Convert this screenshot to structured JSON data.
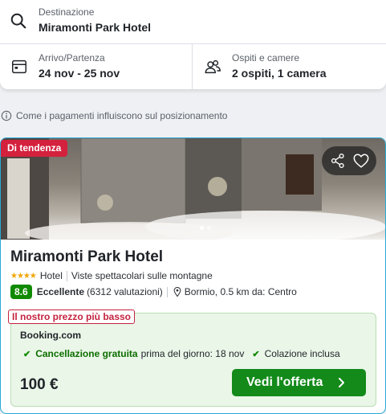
{
  "search": {
    "destination_label": "Destinazione",
    "destination_value": "Miramonti Park Hotel",
    "dates_label": "Arrivo/Partenza",
    "dates_value": "24 nov - 25 nov",
    "guests_label": "Ospiti e camere",
    "guests_value": "2 ospiti, 1 camera"
  },
  "info_text": "Come i pagamenti influiscono sul posizionamento",
  "hotel": {
    "badge": "Di tendenza",
    "name": "Miramonti Park Hotel",
    "star_glyphs": "★★★★",
    "type": "Hotel",
    "highlight": "Viste spettacolari sulle montagne",
    "score": "8.6",
    "score_word": "Eccellente",
    "reviews": "(6312 valutazioni)",
    "location": "Bormio, 0.5 km da: Centro",
    "photo_count_dots": 2
  },
  "offer": {
    "price_label": "Il nostro prezzo più basso",
    "provider": "Booking.com",
    "perk1_strong": "Cancellazione gratuita",
    "perk1_rest": "prima del giorno: 18 nov",
    "perk2": "Colazione inclusa",
    "price": "100 €",
    "cta": "Vedi l'offerta"
  },
  "colors": {
    "accent_green": "#138a1a",
    "badge_red": "#d4213d",
    "card_border": "#2aa8d8",
    "score_green": "#108a00"
  },
  "icons": [
    "search-icon",
    "calendar-icon",
    "guests-icon",
    "info-icon",
    "share-icon",
    "heart-icon",
    "map-pin-icon",
    "check-icon",
    "chevron-right-icon"
  ]
}
